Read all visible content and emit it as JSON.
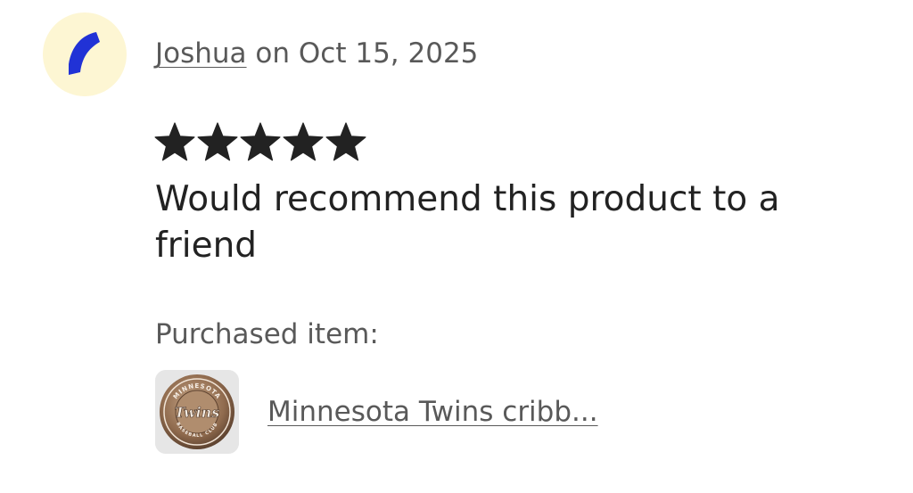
{
  "review": {
    "avatar_icon": "crescent-avatar-icon",
    "avatar_bg_color": "#fdf6d3",
    "avatar_fg_color": "#2132d6",
    "reviewer_name": "Joshua",
    "date_connector": " on ",
    "date": "Oct 15, 2025",
    "rating": 5,
    "rating_max": 5,
    "text": "Would recommend this product to a friend"
  },
  "purchased": {
    "label": "Purchased item:",
    "thumbnail_icon": "minnesota-twins-badge-thumbnail",
    "thumbnail_lettering": {
      "top": "MINNESOTA",
      "middle": "Twins",
      "bottom": "BASEBALL CLUB"
    },
    "item_title": "Minnesota Twins cribb..."
  }
}
